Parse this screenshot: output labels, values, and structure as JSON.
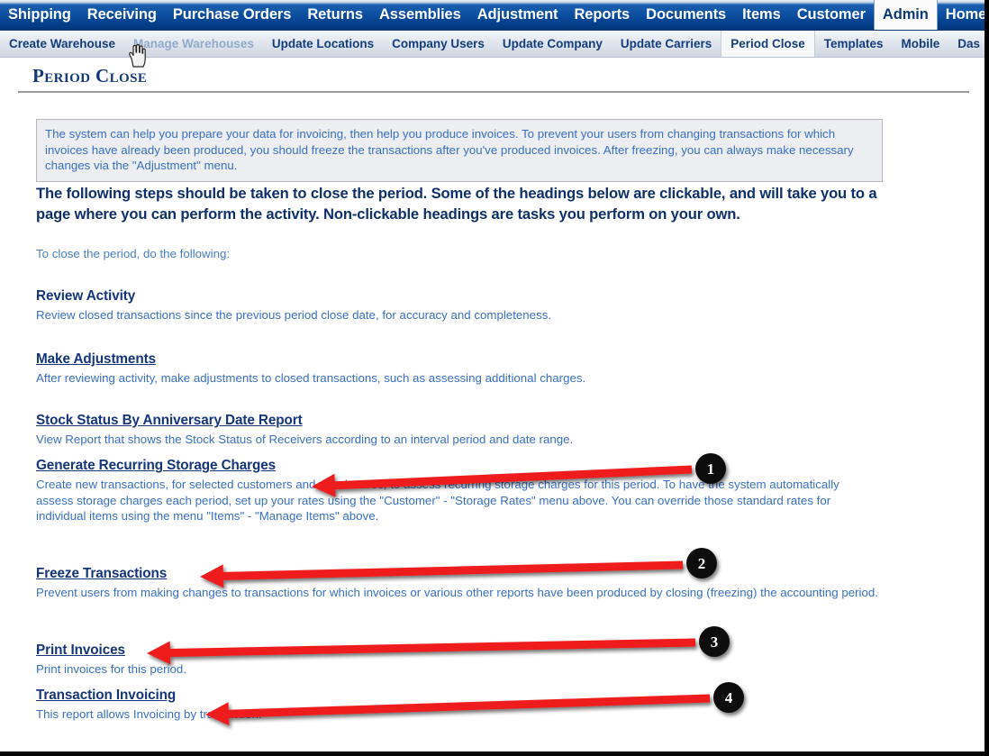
{
  "primary_nav": {
    "items": [
      {
        "label": "Shipping",
        "active": false
      },
      {
        "label": "Receiving",
        "active": false
      },
      {
        "label": "Purchase Orders",
        "active": false
      },
      {
        "label": "Returns",
        "active": false
      },
      {
        "label": "Assemblies",
        "active": false
      },
      {
        "label": "Adjustment",
        "active": false
      },
      {
        "label": "Reports",
        "active": false
      },
      {
        "label": "Documents",
        "active": false
      },
      {
        "label": "Items",
        "active": false
      },
      {
        "label": "Customer",
        "active": false
      },
      {
        "label": "Admin",
        "active": true
      },
      {
        "label": "Home",
        "active": false
      }
    ]
  },
  "secondary_nav": {
    "items": [
      {
        "label": "Create Warehouse",
        "state": "normal"
      },
      {
        "label": "Manage Warehouses",
        "state": "hover"
      },
      {
        "label": "Update Locations",
        "state": "normal"
      },
      {
        "label": "Company Users",
        "state": "normal"
      },
      {
        "label": "Update Company",
        "state": "normal"
      },
      {
        "label": "Update Carriers",
        "state": "normal"
      },
      {
        "label": "Period Close",
        "state": "active"
      },
      {
        "label": "Templates",
        "state": "normal"
      },
      {
        "label": "Mobile",
        "state": "normal"
      },
      {
        "label": "Das",
        "state": "normal"
      }
    ]
  },
  "page": {
    "title": "Period Close",
    "info_box": "The system can help you prepare your data for invoicing, then help you produce invoices. To prevent your users from changing transactions for which invoices have already been produced, you should freeze the transactions after you've produced invoices. After freezing, you can always make necessary changes via the \"Adjustment\" menu.",
    "steps_heading": "The following steps should be taken to close the period. Some of the headings below are clickable, and will take you to a page where you can perform the activity. Non-clickable headings are tasks you perform on your own.",
    "steps_intro": "To close the period, do the following:"
  },
  "sections": [
    {
      "title": "Review Activity",
      "clickable": false,
      "description": "Review closed transactions since the previous period close date, for accuracy and completeness."
    },
    {
      "title": "Make Adjustments",
      "clickable": true,
      "description": "After reviewing activity, make adjustments to closed transactions, such as assessing additional charges."
    },
    {
      "title": "Stock Status By Anniversary Date Report",
      "clickable": true,
      "description": "View Report that shows the Stock Status of Receivers according to an interval period and date range."
    },
    {
      "title": "Generate Recurring Storage Charges",
      "clickable": true,
      "description": "Create new transactions, for selected customers and warehouses, to assess recurring storage charges for this period. To have the system automatically assess storage charges each period, set up your rates using the \"Customer\" - \"Storage Rates\" menu above. You can override those standard rates for individual items using the menu \"Items\" - \"Manage Items\" above."
    },
    {
      "title": "Freeze Transactions",
      "clickable": true,
      "description": "Prevent users from making changes to transactions for which invoices or various other reports have been produced by closing (freezing) the accounting period."
    },
    {
      "title": "Print Invoices",
      "clickable": true,
      "description": "Print invoices for this period."
    },
    {
      "title": "Transaction Invoicing",
      "clickable": true,
      "description": "This report allows Invoicing by transaction."
    }
  ],
  "annotations": {
    "arrow_color": "#ee1c1c",
    "badge_color": "#0b0b0b",
    "badge_text_color": "#ffffff",
    "markers": [
      {
        "number": "1",
        "target": "Generate Recurring Storage Charges"
      },
      {
        "number": "2",
        "target": "Freeze Transactions"
      },
      {
        "number": "3",
        "target": "Print Invoices"
      },
      {
        "number": "4",
        "target": "Transaction Invoicing"
      }
    ]
  },
  "cursor": {
    "type": "pointer-hand",
    "over": "Manage Warehouses"
  }
}
